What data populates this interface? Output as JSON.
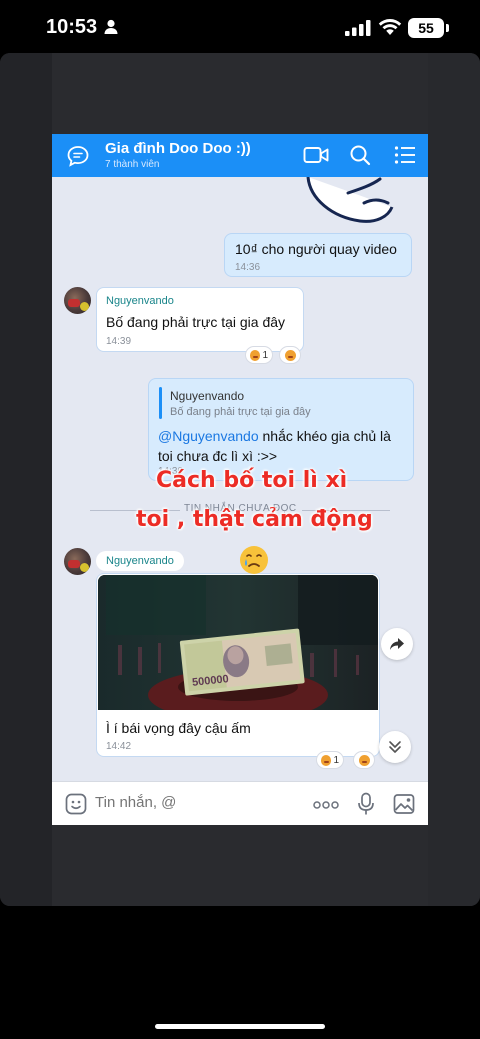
{
  "status_bar": {
    "time": "10:53",
    "battery": "55"
  },
  "header": {
    "title": "Gia đình Doo Doo :))",
    "subtitle": "7 thành viên"
  },
  "messages": [
    {
      "id": "m1",
      "text": "10₫ cho người quay video",
      "time": "14:36"
    },
    {
      "id": "m2",
      "sender": "Nguyenvando",
      "text": "Bố đang phải trực tại gia đây",
      "time": "14:39",
      "reaction_count": "1"
    },
    {
      "id": "m3",
      "quote_sender": "Nguyenvando",
      "quote_text": "Bố đang phải trực tại gia đây",
      "mention": "@Nguyenvando",
      "text_rest": " nhắc khéo gia chủ là",
      "text_line2": "toi chưa đc lì xì :>>",
      "time": "14:39"
    },
    {
      "id": "m4",
      "sender": "Nguyenvando",
      "caption": "Ì í bái vọng đây cậu ấm",
      "time": "14:42",
      "reaction_count": "1",
      "banknote_value": "500000"
    }
  ],
  "unread_divider": "TIN NHẮN CHƯA ĐỌC",
  "overlay": {
    "line1": "Cách bố toi lì xì",
    "line2": "toi , thật cảm động"
  },
  "composer": {
    "placeholder": "Tin nhắn, @"
  },
  "colors": {
    "header_bg": "#1b8ff7",
    "chat_bg": "#e4e8f2",
    "my_bubble": "#d7ebfd",
    "overlay_text": "#ec2c25"
  },
  "icons": [
    "chat-icon",
    "video-call-icon",
    "search-icon",
    "menu-icon",
    "share-icon",
    "scroll-down-icon",
    "sticker-icon",
    "more-icon",
    "mic-icon",
    "image-icon",
    "crying-emoji-icon"
  ]
}
